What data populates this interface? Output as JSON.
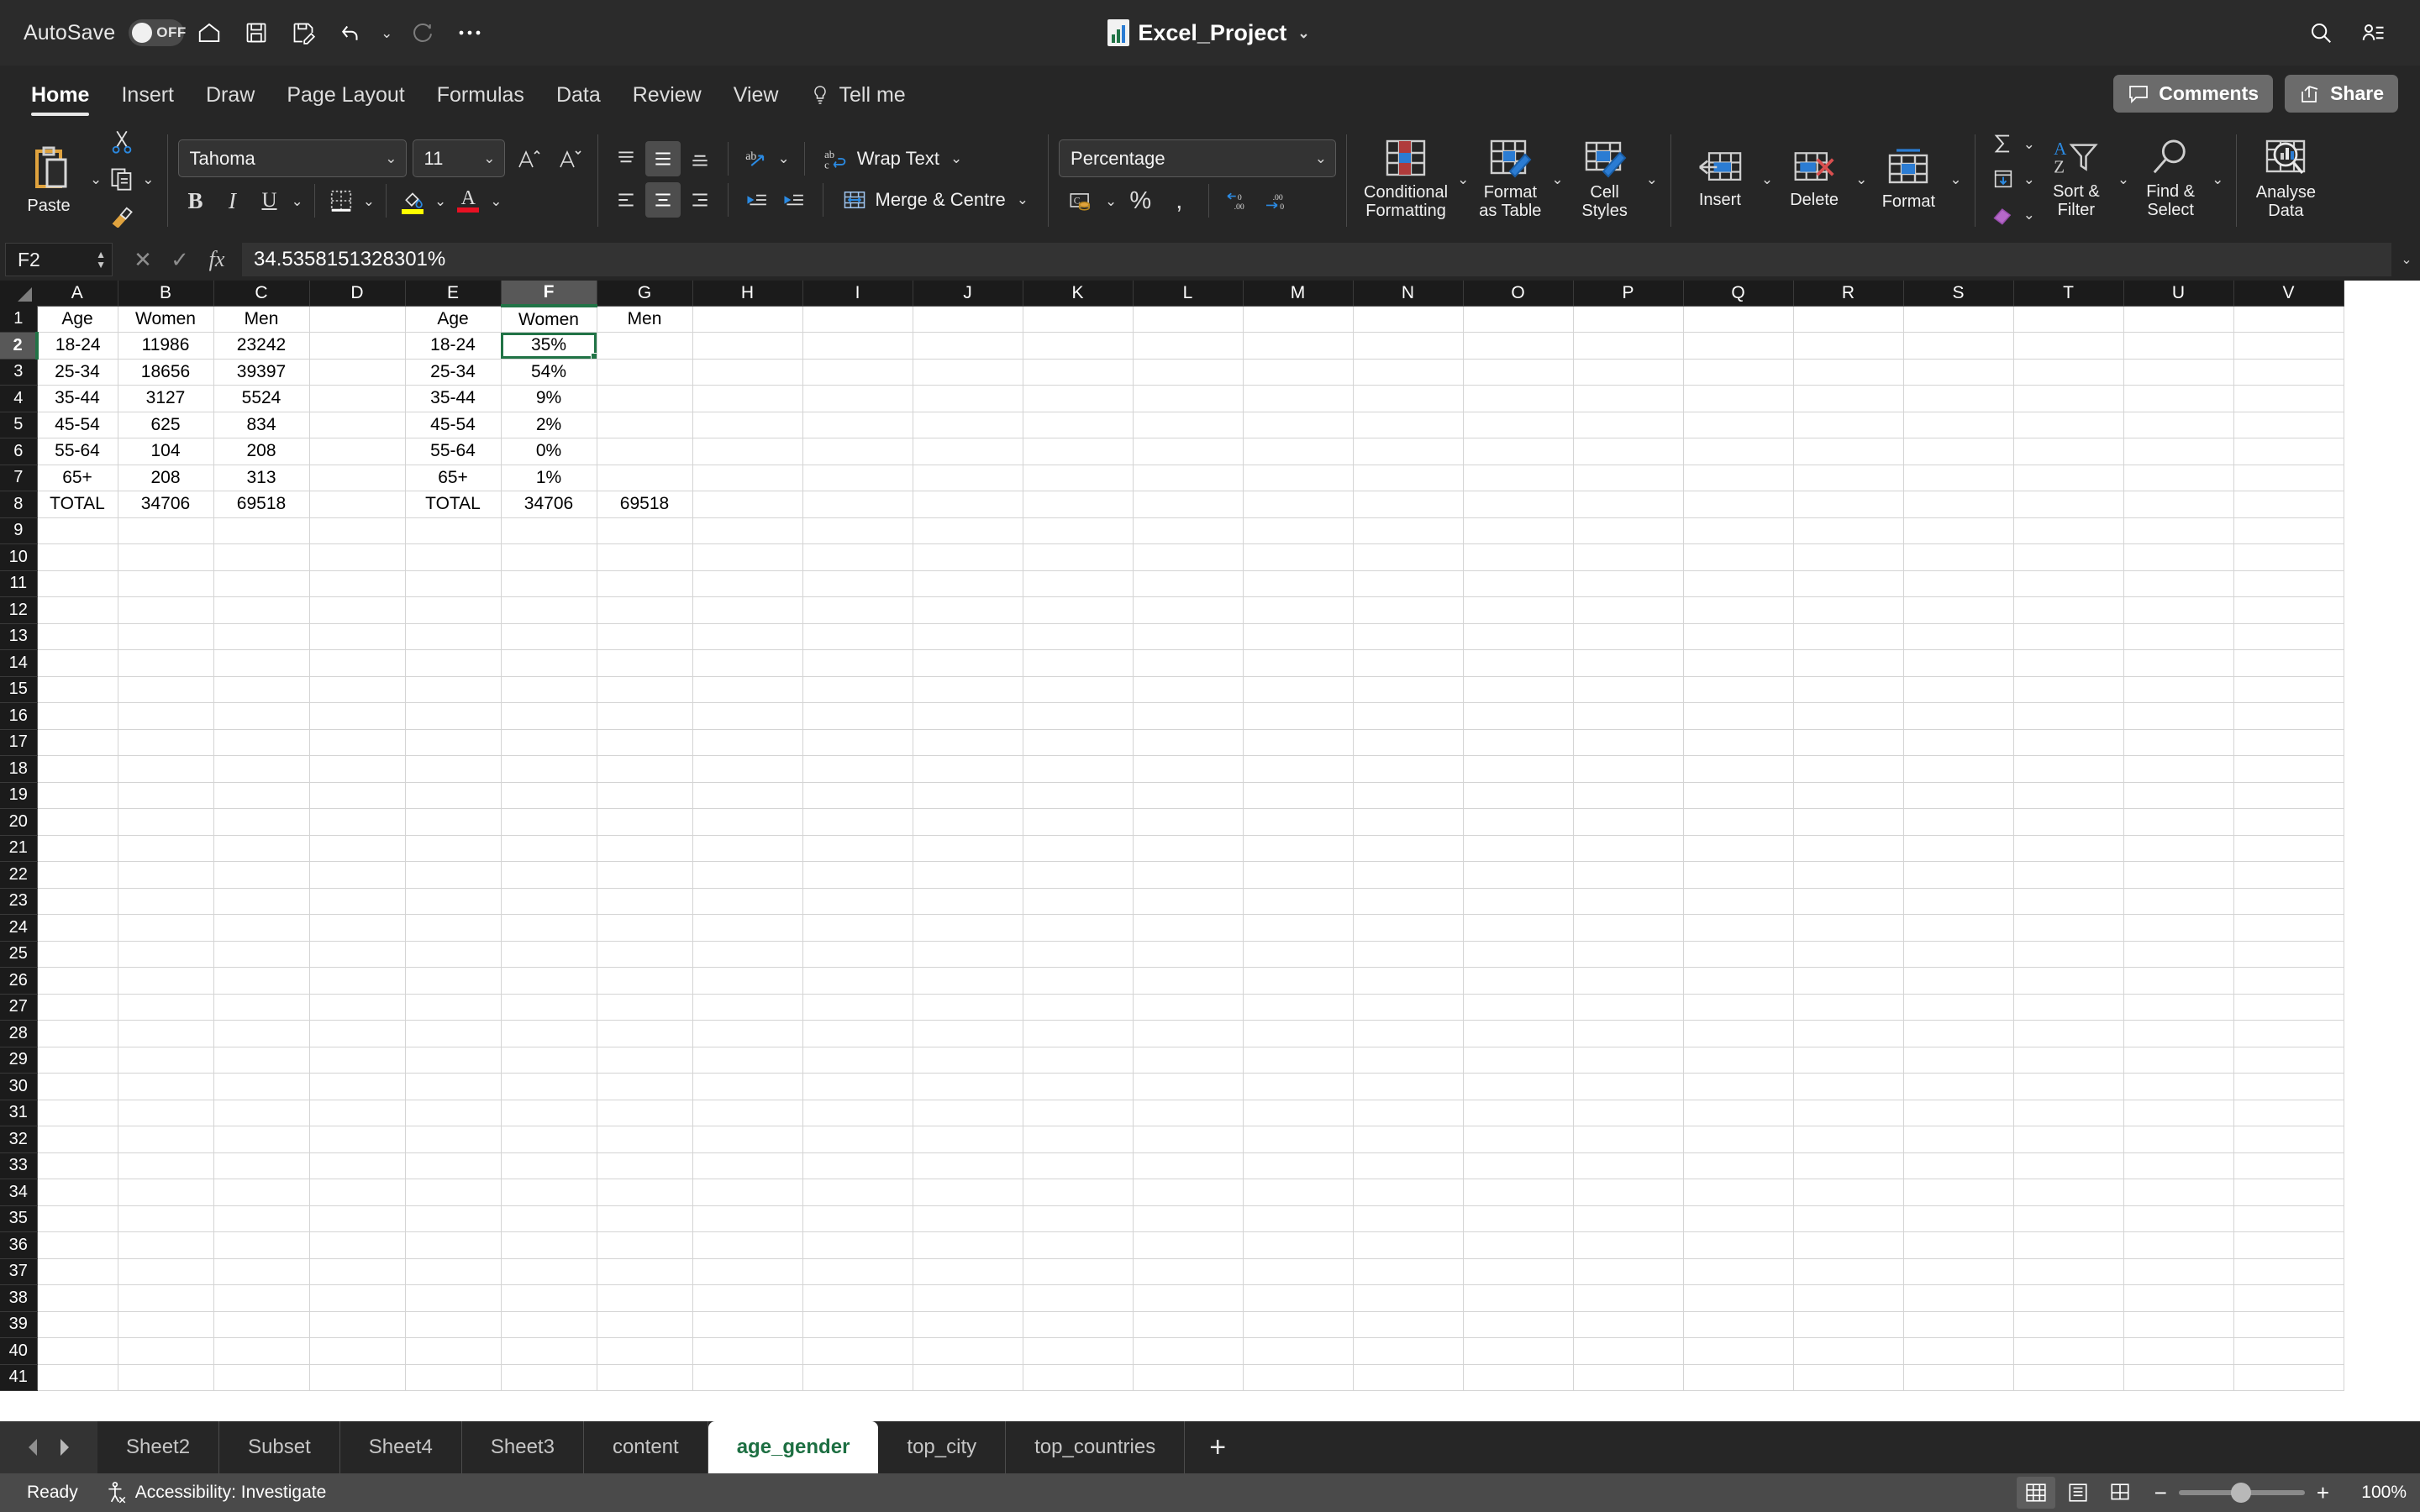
{
  "titlebar": {
    "autosave_label": "AutoSave",
    "autosave_state": "OFF",
    "document_title": "Excel_Project",
    "quick_access": [
      "home-icon",
      "save-icon",
      "save-as-icon",
      "undo-icon",
      "redo-icon",
      "more-icon"
    ],
    "search_icon": "search-icon",
    "account_icon": "account-icon"
  },
  "ribbon_tabs": {
    "items": [
      {
        "label": "Home",
        "active": true
      },
      {
        "label": "Insert",
        "active": false
      },
      {
        "label": "Draw",
        "active": false
      },
      {
        "label": "Page Layout",
        "active": false
      },
      {
        "label": "Formulas",
        "active": false
      },
      {
        "label": "Data",
        "active": false
      },
      {
        "label": "Review",
        "active": false
      },
      {
        "label": "View",
        "active": false
      }
    ],
    "tell_me": "Tell me",
    "comments": "Comments",
    "share": "Share"
  },
  "ribbon": {
    "clipboard": {
      "paste_label": "Paste",
      "cut_icon": "scissors-icon",
      "copy_icon": "copy-icon",
      "format_painter_icon": "format-painter-icon"
    },
    "font": {
      "font_family": "Tahoma",
      "font_size": "11",
      "grow_font": "A^",
      "shrink_font": "Av",
      "bold": "B",
      "italic": "I",
      "underline": "U",
      "borders_icon": "borders-icon",
      "fill_color_icon": "fill-color-icon",
      "fill_color": "#FFFF00",
      "font_color_icon": "font-color-icon",
      "font_color": "#E81123"
    },
    "alignment": {
      "align_top": "align-top-icon",
      "align_middle": "align-middle-icon",
      "align_bottom": "align-bottom-icon",
      "orientation": "text-orientation-icon",
      "align_left": "align-left-icon",
      "align_center": "align-center-icon",
      "align_right": "align-right-icon",
      "decrease_indent": "decrease-indent-icon",
      "increase_indent": "increase-indent-icon",
      "wrap_text": "Wrap Text",
      "merge_centre": "Merge & Centre"
    },
    "number": {
      "format": "Percentage",
      "accounting_icon": "accounting-number-format-icon",
      "percent_style": "%",
      "comma_style": ",",
      "decrease_decimal": "decrease-decimal-icon",
      "increase_decimal": "increase-decimal-icon"
    },
    "styles": {
      "conditional_formatting": "Conditional\nFormatting",
      "conditional_formatting_l1": "Conditional",
      "conditional_formatting_l2": "Formatting",
      "format_as_table_l1": "Format",
      "format_as_table_l2": "as Table",
      "cell_styles_l1": "Cell",
      "cell_styles_l2": "Styles"
    },
    "cells": {
      "insert": "Insert",
      "delete": "Delete",
      "format": "Format"
    },
    "editing": {
      "autosum_icon": "autosum-icon",
      "fill_icon": "fill-down-icon",
      "clear_icon": "clear-eraser-icon",
      "sort_filter_l1": "Sort &",
      "sort_filter_l2": "Filter",
      "find_select_l1": "Find &",
      "find_select_l2": "Select"
    },
    "analysis": {
      "analyse_data_l1": "Analyse",
      "analyse_data_l2": "Data"
    }
  },
  "formula_bar": {
    "name_box": "F2",
    "cancel_icon": "cancel-x-icon",
    "enter_icon": "enter-check-icon",
    "fx_icon": "fx-icon",
    "formula": "34.5358151328301%"
  },
  "grid": {
    "columns": [
      "A",
      "B",
      "C",
      "D",
      "E",
      "F",
      "G",
      "H",
      "I",
      "J",
      "K",
      "L",
      "M",
      "N",
      "O",
      "P",
      "Q",
      "R",
      "S",
      "T",
      "U",
      "V"
    ],
    "selected_column": "F",
    "selected_row": 2,
    "selected_cell": "F2",
    "row_count": 41,
    "cells": {
      "1": {
        "A": "Age",
        "B": "Women",
        "C": "Men",
        "E": "Age",
        "F": "Women",
        "G": "Men"
      },
      "2": {
        "A": "18-24",
        "B": "11986",
        "C": "23242",
        "E": "18-24",
        "F": "35%"
      },
      "3": {
        "A": "25-34",
        "B": "18656",
        "C": "39397",
        "E": "25-34",
        "F": "54%"
      },
      "4": {
        "A": "35-44",
        "B": "3127",
        "C": "5524",
        "E": "35-44",
        "F": "9%"
      },
      "5": {
        "A": "45-54",
        "B": "625",
        "C": "834",
        "E": "45-54",
        "F": "2%"
      },
      "6": {
        "A": "55-64",
        "B": "104",
        "C": "208",
        "E": "55-64",
        "F": "0%"
      },
      "7": {
        "A": "65+",
        "B": "208",
        "C": "313",
        "E": "65+",
        "F": "1%"
      },
      "8": {
        "A": "TOTAL",
        "B": "34706",
        "C": "69518",
        "E": "TOTAL",
        "F": "34706",
        "G": "69518"
      }
    }
  },
  "sheet_tabs": {
    "items": [
      {
        "label": "Sheet2",
        "active": false
      },
      {
        "label": "Subset",
        "active": false
      },
      {
        "label": "Sheet4",
        "active": false
      },
      {
        "label": "Sheet3",
        "active": false
      },
      {
        "label": "content",
        "active": false
      },
      {
        "label": "age_gender",
        "active": true
      },
      {
        "label": "top_city",
        "active": false
      },
      {
        "label": "top_countries",
        "active": false
      }
    ],
    "add_sheet": "+"
  },
  "status_bar": {
    "state": "Ready",
    "accessibility": "Accessibility: Investigate",
    "view_normal": "normal-view-icon",
    "view_page_layout": "page-layout-view-icon",
    "view_page_break": "page-break-view-icon",
    "zoom_out": "−",
    "zoom_in": "+",
    "zoom_level": "100%"
  }
}
